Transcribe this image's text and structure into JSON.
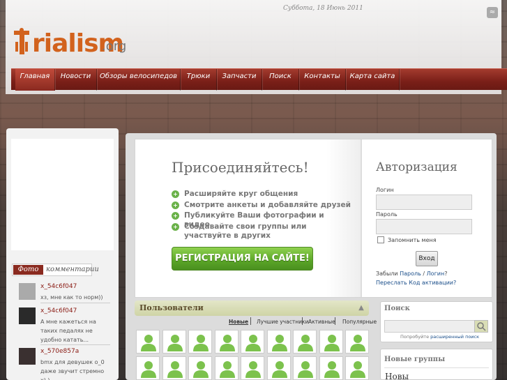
{
  "header": {
    "date": "Суббота, 18 Июнь 2011",
    "logo_text": "rialism",
    "logo_tld": ".org"
  },
  "nav": {
    "items": [
      {
        "label": "Главная"
      },
      {
        "label": "Новости"
      },
      {
        "label": "Обзоры велосипедов"
      },
      {
        "label": "Трюки"
      },
      {
        "label": "Запчасти"
      },
      {
        "label": "Поиск"
      },
      {
        "label": "Контакты"
      },
      {
        "label": "Карта сайта"
      }
    ]
  },
  "photo_comments": {
    "title_photo": "Фото",
    "title_comments": "комментарии",
    "items": [
      {
        "user": "x_54c6f047",
        "text": "хз, мне как то норм))"
      },
      {
        "user": "x_54c6f047",
        "text": "А мне кажеться на таких педалях не удобно катать..."
      },
      {
        "user": "x_570e857a",
        "text": "bmx для девушек о_0 даже звучит стремно х),)"
      }
    ]
  },
  "join": {
    "title": "Присоединяйтесь!",
    "bullets": [
      "Расширяйте круг общения",
      "Смотрите анкеты и добавляйте друзей",
      "Публикуйте Ваши фотографии и видео",
      "Создавайте свои группы или участвуйте в других"
    ],
    "register_label": "РЕГИСТРАЦИЯ НА САЙТЕ!"
  },
  "auth": {
    "title": "Авторизация",
    "login_label": "Логин",
    "password_label": "Пароль",
    "remember_label": "Запомнить меня",
    "login_button": "Вход",
    "forgot_prefix": "Забыли",
    "forgot_password": "Пароль",
    "forgot_sep": "/",
    "forgot_login": "Логин",
    "forgot_suffix": "?",
    "resend": "Переслать Код активации?"
  },
  "users": {
    "title": "Пользователи",
    "tabs": [
      "Новые",
      "Лучшие участники",
      "Активные",
      "Популярные"
    ],
    "grid_count": 18
  },
  "search": {
    "title": "Поиск",
    "hint_prefix": "Попробуйте",
    "hint_link": "расширенный поиск"
  },
  "groups": {
    "title": "Новые группы",
    "first_item": "Новы"
  },
  "colors": {
    "accent": "#8a1a12",
    "nav": "#7a1f18",
    "register_green": "#5aa527",
    "logo_orange": "#d2621d"
  }
}
